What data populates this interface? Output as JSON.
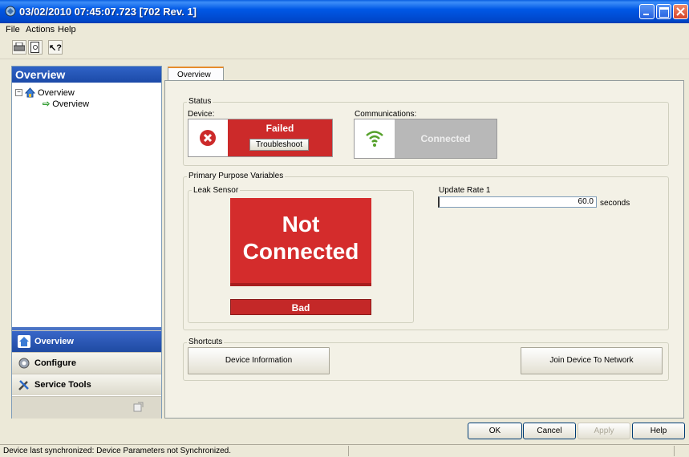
{
  "window": {
    "title": "03/02/2010 07:45:07.723 [702 Rev. 1]"
  },
  "menu": {
    "file": "File",
    "actions": "Actions",
    "help": "Help"
  },
  "toolbar": {
    "print_icon": "printer-icon",
    "preview_icon": "print-preview-icon",
    "help_icon": "context-help-icon"
  },
  "nav": {
    "header": "Overview",
    "tree_root": "Overview",
    "tree_child": "Overview",
    "buttons": [
      {
        "label": "Overview",
        "icon": "home-icon"
      },
      {
        "label": "Configure",
        "icon": "configure-icon"
      },
      {
        "label": "Service Tools",
        "icon": "tools-icon"
      }
    ]
  },
  "tab": {
    "label": "Overview"
  },
  "status": {
    "group_label": "Status",
    "device_label": "Device:",
    "device_state": "Failed",
    "troubleshoot": "Troubleshoot",
    "comm_label": "Communications:",
    "comm_state": "Connected"
  },
  "ppv": {
    "group_label": "Primary Purpose Variables",
    "sensor_label": "Leak Sensor",
    "sensor_value_line1": "Not",
    "sensor_value_line2": "Connected",
    "sensor_quality": "Bad",
    "update_rate_label": "Update Rate 1",
    "update_rate_value": "60.0",
    "update_rate_unit": "seconds"
  },
  "shortcuts": {
    "group_label": "Shortcuts",
    "device_info": "Device Information",
    "join_network": "Join Device To Network"
  },
  "dialog": {
    "ok": "OK",
    "cancel": "Cancel",
    "apply": "Apply",
    "help": "Help"
  },
  "statusbar": {
    "text": "Device last synchronized: Device Parameters not Synchronized."
  },
  "colors": {
    "failed_red": "#cc2a2a",
    "connected_grey": "#b8b8b8",
    "nav_blue": "#1f4aa2"
  }
}
